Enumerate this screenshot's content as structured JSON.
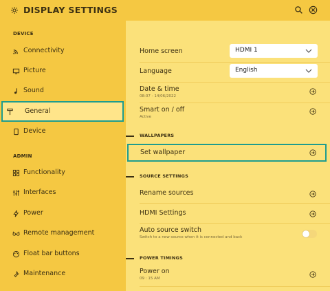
{
  "header": {
    "title": "DISPLAY SETTINGS",
    "icons": [
      "gear-icon",
      "search-icon",
      "close-circle-icon"
    ]
  },
  "sidebar": {
    "sections": [
      {
        "title": "DEVICE",
        "items": [
          {
            "label": "Connectivity",
            "icon": "wifi-icon"
          },
          {
            "label": "Picture",
            "icon": "monitor-icon"
          },
          {
            "label": "Sound",
            "icon": "music-note-icon"
          },
          {
            "label": "General",
            "icon": "signpost-icon",
            "active": true
          },
          {
            "label": "Device",
            "icon": "tablet-icon"
          }
        ]
      },
      {
        "title": "ADMIN",
        "items": [
          {
            "label": "Functionality",
            "icon": "grid-icon"
          },
          {
            "label": "Interfaces",
            "icon": "sliders-icon"
          },
          {
            "label": "Power",
            "icon": "lightning-icon"
          },
          {
            "label": "Remote management",
            "icon": "glasses-icon"
          },
          {
            "label": "Float bar buttons",
            "icon": "palette-icon"
          },
          {
            "label": "Maintenance",
            "icon": "wrench-icon"
          }
        ]
      }
    ]
  },
  "main": {
    "home_screen": {
      "label": "Home screen",
      "value": "HDMI 1"
    },
    "language": {
      "label": "Language",
      "value": "English"
    },
    "date_time": {
      "label": "Date & time",
      "sub": "08:07 - 14/06/2022"
    },
    "smart_on_off": {
      "label": "Smart on / off",
      "sub": "Active"
    },
    "wallpapers": {
      "heading": "WALLPAPERS",
      "set_wallpaper": "Set wallpaper"
    },
    "source_settings": {
      "heading": "SOURCE SETTINGS",
      "rename_sources": "Rename sources",
      "hdmi_settings": "HDMI Settings",
      "auto_source_switch": {
        "label": "Auto source switch",
        "sub": "Switch to a new source when it is connected and back",
        "enabled": false
      }
    },
    "power_timings": {
      "heading": "POWER TIMINGS",
      "power_on": {
        "label": "Power on",
        "sub": "09 : 15 AM"
      }
    }
  },
  "colors": {
    "sidebar_bg": "#f5c842",
    "main_bg": "#fbe17a",
    "highlight_border": "#1e9c8e",
    "text": "#3b2f12"
  }
}
